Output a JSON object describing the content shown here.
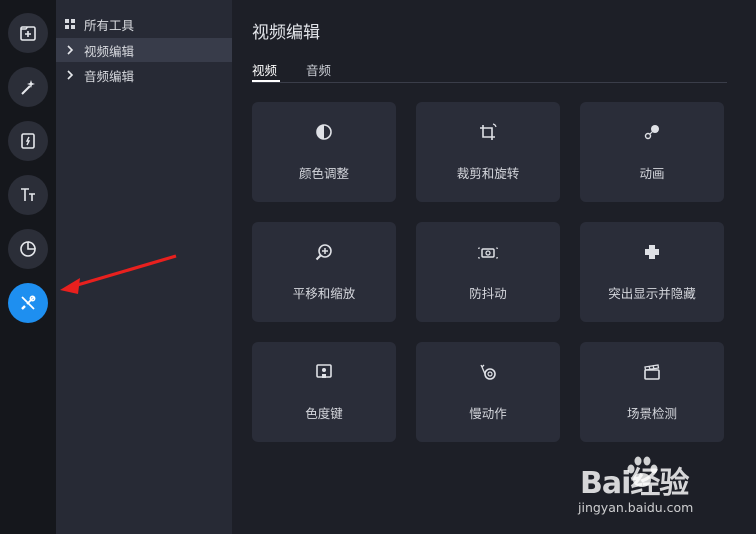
{
  "rail": {
    "buttons": [
      {
        "icon": "folder-add-icon",
        "active": false
      },
      {
        "icon": "magic-wand-icon",
        "active": false
      },
      {
        "icon": "transition-icon",
        "active": false
      },
      {
        "icon": "text-tt-icon",
        "active": false
      },
      {
        "icon": "sticker-icon",
        "active": false
      },
      {
        "icon": "tools-icon",
        "active": true
      }
    ],
    "active_color": "#1e8ff0"
  },
  "tree": {
    "items": [
      {
        "label": "所有工具",
        "icon": "grid-icon"
      },
      {
        "label": "视频编辑",
        "icon": "chevron-right-icon",
        "selected": true
      },
      {
        "label": "音频编辑",
        "icon": "chevron-right-icon"
      }
    ]
  },
  "main": {
    "title": "视频编辑",
    "tabs": [
      {
        "label": "视频",
        "active": true
      },
      {
        "label": "音频",
        "active": false
      }
    ],
    "tools": [
      {
        "label": "颜色调整",
        "icon": "color-adjust-icon"
      },
      {
        "label": "裁剪和旋转",
        "icon": "crop-rotate-icon"
      },
      {
        "label": "动画",
        "icon": "animation-icon"
      },
      {
        "label": "平移和缩放",
        "icon": "pan-zoom-icon"
      },
      {
        "label": "防抖动",
        "icon": "stabilize-icon"
      },
      {
        "label": "突出显示并隐藏",
        "icon": "highlight-hide-icon"
      },
      {
        "label": "色度键",
        "icon": "chroma-key-icon"
      },
      {
        "label": "慢动作",
        "icon": "slow-motion-icon"
      },
      {
        "label": "场景检测",
        "icon": "scene-detect-icon"
      }
    ]
  },
  "annotation": {
    "color": "#e8201e"
  },
  "watermark": {
    "line1": "Bai经验",
    "line2": "jingyan.baidu.com"
  }
}
